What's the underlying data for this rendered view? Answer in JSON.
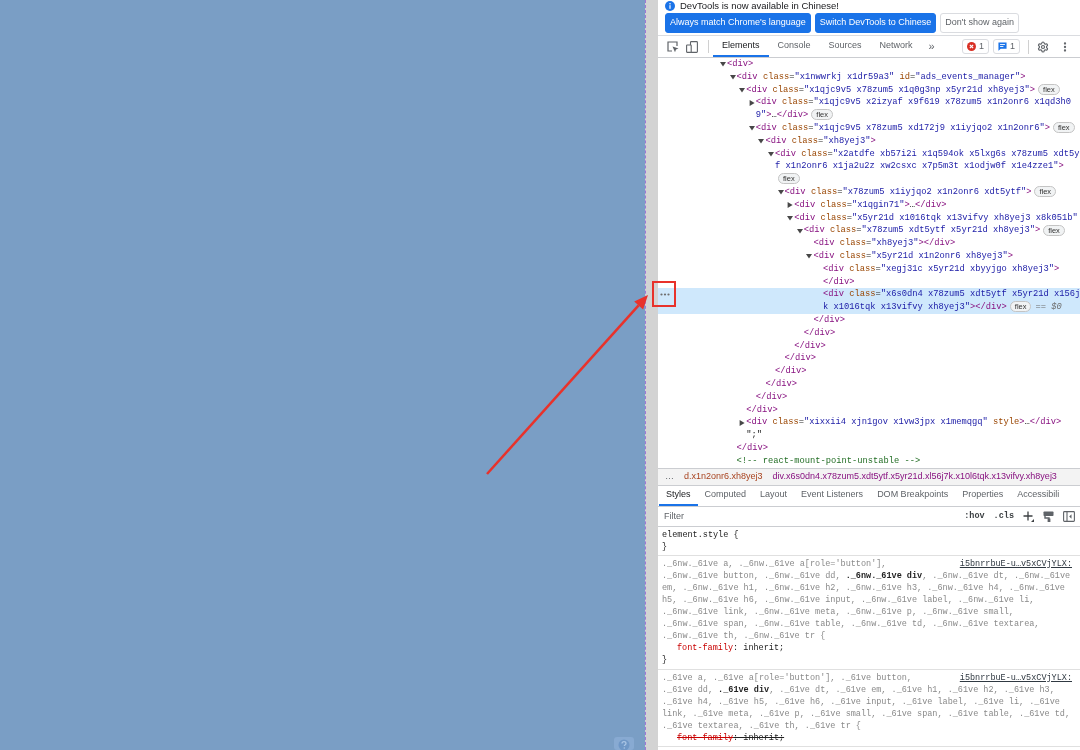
{
  "devtools": {
    "infobar": {
      "message": "DevTools is now available in Chinese!",
      "buttons": [
        {
          "label": "Always match Chrome's language",
          "kind": "primary"
        },
        {
          "label": "Switch DevTools to Chinese",
          "kind": "primary"
        },
        {
          "label": "Don't show again",
          "kind": "secondary"
        }
      ]
    },
    "panel_tabs": [
      {
        "label": "Elements",
        "selected": true
      },
      {
        "label": "Console",
        "selected": false
      },
      {
        "label": "Sources",
        "selected": false
      },
      {
        "label": "Network",
        "selected": false
      }
    ],
    "more_tabs": "»",
    "counters": [
      {
        "kind": "error",
        "count": "1"
      },
      {
        "kind": "message",
        "count": "1"
      }
    ],
    "dom_tree": [
      {
        "kind": "element",
        "selected": false,
        "expanded": true,
        "open": [
          "<div>"
        ],
        "children": [
          {
            "kind": "element",
            "selected": false,
            "expanded": true,
            "open": [
              "<div class=\"x1nwwrkj x1dr59a3\" id=\"ads_events_manager\">"
            ],
            "children": [
              {
                "kind": "element",
                "selected": false,
                "expanded": true,
                "open": [
                  "<div class=\"x1qjc9v5 x78zum5 x1q0g3np x5yr21d xh8yej3\">"
                ],
                "badge": "flex",
                "children": [
                  {
                    "kind": "element",
                    "selected": false,
                    "expanded": false,
                    "open": [
                      "<div class=\"x1qjc9v5 x2izyaf x9f619 x78zum5 x1n2onr6 x1qd3h0",
                      "9\">…</div>"
                    ],
                    "badge": "flex"
                  },
                  {
                    "kind": "element",
                    "selected": false,
                    "expanded": true,
                    "open": [
                      "<div class=\"x1qjc9v5 x78zum5 xd172j9 x1iyjqo2 x1n2onr6\">"
                    ],
                    "badge": "flex",
                    "children": [
                      {
                        "kind": "element",
                        "selected": false,
                        "expanded": true,
                        "open": [
                          "<div class=\"xh8yej3\">"
                        ],
                        "children": [
                          {
                            "kind": "element",
                            "selected": false,
                            "expanded": true,
                            "open": [
                              "<div class=\"x2atdfe xb57i2i x1q594ok x5lxg6s x78zum5 xdt5y",
                              "f x1n2onr6 x1ja2u2z xw2csxc x7p5m3t x1odjw0f x1e4zze1\">"
                            ],
                            "badge": "flex",
                            "children": [
                              {
                                "kind": "element",
                                "selected": false,
                                "expanded": true,
                                "open": [
                                  "<div class=\"x78zum5 x1iyjqo2 x1n2onr6 xdt5ytf\">"
                                ],
                                "badge": "flex",
                                "children": [
                                  {
                                    "kind": "element",
                                    "selected": false,
                                    "expanded": false,
                                    "open": [
                                      "<div class=\"x1qgin71\">…</div>"
                                    ]
                                  },
                                  {
                                    "kind": "element",
                                    "selected": false,
                                    "expanded": true,
                                    "open": [
                                      "<div class=\"x5yr21d x1016tqk x13vifvy xh8yej3 x8k051b\""
                                    ],
                                    "children": [
                                      {
                                        "kind": "element",
                                        "selected": false,
                                        "expanded": true,
                                        "open": [
                                          "<div class=\"x78zum5 xdt5ytf x5yr21d xh8yej3\">"
                                        ],
                                        "badge": "flex",
                                        "children": [
                                          {
                                            "kind": "leaf",
                                            "selected": false,
                                            "open": [
                                              "<div class=\"xh8yej3\"></div>"
                                            ]
                                          },
                                          {
                                            "kind": "element",
                                            "selected": false,
                                            "expanded": true,
                                            "open": [
                                              "<div class=\"x5yr21d x1n2onr6 xh8yej3\">"
                                            ],
                                            "children": [
                                              {
                                                "kind": "leaf",
                                                "selected": false,
                                                "open": [
                                                  "<div class=\"xegj31c x5yr21d xbyyjgo xh8yej3\">"
                                                ],
                                                "close": "</div>"
                                              },
                                              {
                                                "kind": "leaf",
                                                "selected": true,
                                                "open": [
                                                  "<div class=\"x6s0dn4 x78zum5 xdt5ytf x5yr21d x156j",
                                                  "k x1016tqk x13vifvy xh8yej3\"></div>"
                                                ],
                                                "badge": "flex",
                                                "ref": "== $0"
                                              }
                                            ],
                                            "close": "</div>"
                                          }
                                        ],
                                        "close": "</div>"
                                      }
                                    ],
                                    "close": "</div>"
                                  }
                                ],
                                "close": "</div>"
                              }
                            ],
                            "close": "</div>"
                          }
                        ],
                        "close": "</div>"
                      }
                    ],
                    "close": "</div>"
                  }
                ],
                "close": "</div>"
              },
              {
                "kind": "element",
                "selected": false,
                "expanded": false,
                "open": [
                  "<div class=\"xixxii4 xjn1gov x1vw3jpx x1memqgq\" style>…</div>"
                ]
              },
              {
                "kind": "text",
                "selected": false,
                "open": [
                  "\";\""
                ]
              }
            ],
            "close": "</div>"
          },
          {
            "kind": "comment",
            "selected": false,
            "open": [
              "<!-- react-mount-point-unstable -->"
            ]
          }
        ]
      }
    ],
    "breadcrumb_scroll": "…",
    "breadcrumbs": [
      {
        "label": "d.x1n2onr6.xh8yej3",
        "selected": false
      },
      {
        "label": "div.x6s0dn4.x78zum5.xdt5ytf.x5yr21d.xl56j7k.x10l6tqk.x13vifvy.xh8yej3",
        "selected": true
      }
    ],
    "styles": {
      "tabs": [
        {
          "label": "Styles",
          "selected": true
        },
        {
          "label": "Computed",
          "selected": false
        },
        {
          "label": "Layout",
          "selected": false
        },
        {
          "label": "Event Listeners",
          "selected": false
        },
        {
          "label": "DOM Breakpoints",
          "selected": false
        },
        {
          "label": "Properties",
          "selected": false
        },
        {
          "label": "Accessibili",
          "selected": false
        }
      ],
      "filter": {
        "placeholder": "Filter"
      },
      "toggles": [
        ":hov",
        ".cls"
      ],
      "element_style": {
        "open": "element.style {",
        "close": "}"
      },
      "rules": [
        {
          "selector": [
            "._6nw._61ve a, ._6nw._61ve a[role='button'],",
            "._6nw._61ve button, ._6nw._61ve dd, **._6nw._61ve div**, ._6nw._61ve dt, ._6nw._61ve",
            "em, ._6nw._61ve h1, ._6nw._61ve h2, ._6nw._61ve h3, ._6nw._61ve h4, ._6nw._61ve",
            "h5, ._6nw._61ve h6, ._6nw._61ve input, ._6nw._61ve label, ._6nw._61ve li,",
            "._6nw._61ve link, ._6nw._61ve meta, ._6nw._61ve p, ._6nw._61ve small,",
            "._6nw._61ve span, ._6nw._61ve table, ._6nw._61ve td, ._6nw._61ve textarea,",
            "._6nw._61ve th, ._6nw._61ve tr {"
          ],
          "source": "i5bnrrbuE-u…v5xCVjYLX:",
          "declarations": [
            {
              "text": "font-family: inherit;",
              "overridden": false
            }
          ],
          "close": "}"
        },
        {
          "selector": [
            "._61ve a, ._61ve a[role='button'], ._61ve button,",
            "._61ve dd, **._61ve div**, ._61ve dt, ._61ve em, ._61ve h1, ._61ve h2, ._61ve h3,",
            "._61ve h4, ._61ve h5, ._61ve h6, ._61ve input, ._61ve label, ._61ve li, ._61ve",
            "link, ._61ve meta, ._61ve p, ._61ve small, ._61ve span, ._61ve table, ._61ve td,",
            "._61ve textarea, ._61ve th, ._61ve tr {"
          ],
          "source": "i5bnrrbuE-u…v5xCVjYLX:",
          "declarations": [
            {
              "text": "font-family: inherit;",
              "overridden": true
            }
          ]
        }
      ]
    }
  }
}
